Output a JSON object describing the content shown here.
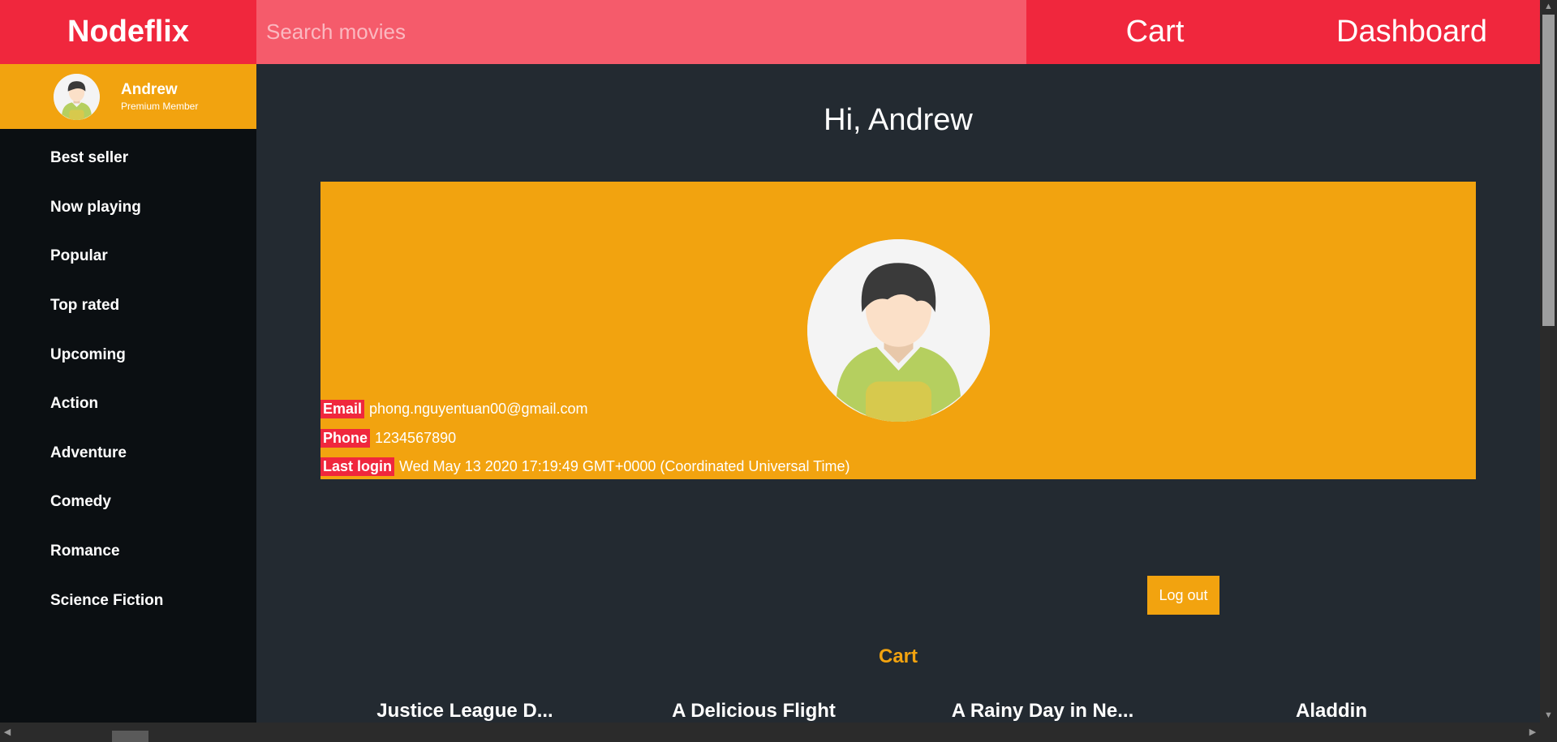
{
  "header": {
    "brand": "Nodeflix",
    "search_placeholder": "Search movies",
    "nav_cart": "Cart",
    "nav_dashboard": "Dashboard"
  },
  "sidebar": {
    "user": {
      "name": "Andrew",
      "tier": "Premium Member",
      "avatar_icon": "user-avatar-icon"
    },
    "items": [
      {
        "label": "Best seller"
      },
      {
        "label": "Now playing"
      },
      {
        "label": "Popular"
      },
      {
        "label": "Top rated"
      },
      {
        "label": "Upcoming"
      },
      {
        "label": "Action"
      },
      {
        "label": "Adventure"
      },
      {
        "label": "Comedy"
      },
      {
        "label": "Romance"
      },
      {
        "label": "Science Fiction"
      }
    ]
  },
  "main": {
    "greeting": "Hi, Andrew",
    "profile": {
      "email_label": "Email",
      "email": "phong.nguyentuan00@gmail.com",
      "phone_label": "Phone",
      "phone": "1234567890",
      "last_login_label": "Last login",
      "last_login": "Wed May 13 2020 17:19:49 GMT+0000 (Coordinated Universal Time)"
    },
    "logout_label": "Log out",
    "cart_heading": "Cart",
    "cart_items": [
      {
        "title": "Justice League D..."
      },
      {
        "title": "A Delicious Flight"
      },
      {
        "title": "A Rainy Day in Ne..."
      },
      {
        "title": "Aladdin"
      }
    ]
  },
  "colors": {
    "brand_red": "#f0273d",
    "search_pink": "#f55b6b",
    "accent_orange": "#f2a30f",
    "sidebar_bg": "#0b0f12",
    "main_bg": "#232a31"
  }
}
